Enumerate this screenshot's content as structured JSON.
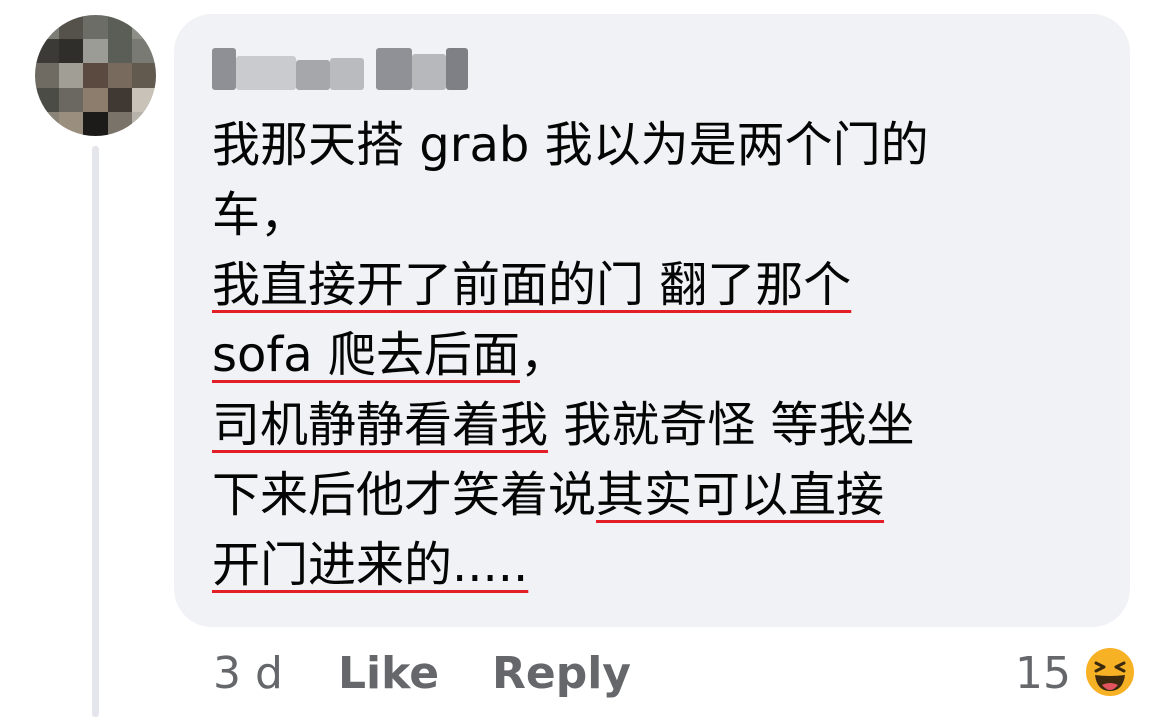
{
  "comment": {
    "author_name": "",
    "lines": [
      {
        "segments": [
          {
            "text": "我那天搭 grab 我以为是两个门的",
            "underlined": false
          }
        ]
      },
      {
        "segments": [
          {
            "text": "车，",
            "underlined": false
          }
        ]
      },
      {
        "segments": [
          {
            "text": "我直接开了前面的门 翻了那个",
            "underlined": true
          }
        ]
      },
      {
        "segments": [
          {
            "text": "sofa 爬去后面",
            "underlined": true
          },
          {
            "text": "，",
            "underlined": false
          }
        ]
      },
      {
        "segments": [
          {
            "text": "司机静静看着我",
            "underlined": true
          },
          {
            "text": " 我就奇怪 等我坐",
            "underlined": false
          }
        ]
      },
      {
        "segments": [
          {
            "text": "下来后他才笑着说",
            "underlined": false
          },
          {
            "text": "其实可以直接",
            "underlined": true
          }
        ]
      },
      {
        "segments": [
          {
            "text": "开门进来的.....",
            "underlined": true
          }
        ]
      }
    ]
  },
  "actions": {
    "timestamp": "3 d",
    "like_label": "Like",
    "reply_label": "Reply",
    "reaction_count": "15",
    "reaction_icon": "haha-reaction-icon"
  },
  "colors": {
    "bubble_background": "#f0f2f5",
    "underline": "#e41e27",
    "text": "#050505",
    "meta_text": "#65676b",
    "thread_line": "#e4e6eb",
    "reaction_yellow": "#f7b125"
  }
}
